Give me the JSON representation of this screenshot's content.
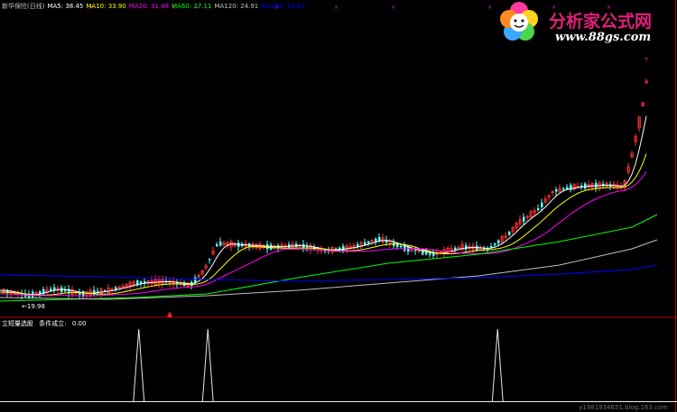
{
  "legend": [
    {
      "text": "新华保险(日线)",
      "color": "#c0c0c0"
    },
    {
      "text": "MA5: 38.45",
      "color": "#ffffff"
    },
    {
      "text": "MA10: 33.90",
      "color": "#ffff00"
    },
    {
      "text": "MA20: 31.48",
      "color": "#ff00ff"
    },
    {
      "text": "MA60: 27.11",
      "color": "#00ff00"
    },
    {
      "text": "MA120: 24.91",
      "color": "#c0c0c0"
    },
    {
      "text": "MA250: 20.63",
      "color": "#0000ff"
    }
  ],
  "low_marker": "←19.98",
  "sub_panel": {
    "title": "立短量选股",
    "label": "条件成立:",
    "value": "0.00"
  },
  "logo": {
    "name": "分析家公式网",
    "url": "www.88gs.com"
  },
  "watermark": "y1981934651.blog.163.com",
  "colors": {
    "up": "#ff3232",
    "down": "#54ffff",
    "ma5": "#ffffff",
    "ma10": "#ffff00",
    "ma20": "#ff00ff",
    "ma60": "#00ff00",
    "ma120": "#c0c0c0",
    "ma250": "#0000ff",
    "frame": "#b00000"
  },
  "chart_data": [
    {
      "type": "candlestick",
      "title": "新华保险(日线)",
      "series_ma": [
        {
          "name": "MA5",
          "last": 38.45
        },
        {
          "name": "MA10",
          "last": 33.9
        },
        {
          "name": "MA20",
          "last": 31.48
        },
        {
          "name": "MA60",
          "last": 27.11
        },
        {
          "name": "MA120",
          "last": 24.91
        },
        {
          "name": "MA250",
          "last": 20.63
        }
      ],
      "low_annotation": 19.98
    },
    {
      "type": "line",
      "title": "立短量选股",
      "current_value": 0.0,
      "signals_at_fraction": [
        0.205,
        0.307,
        0.735
      ]
    }
  ]
}
